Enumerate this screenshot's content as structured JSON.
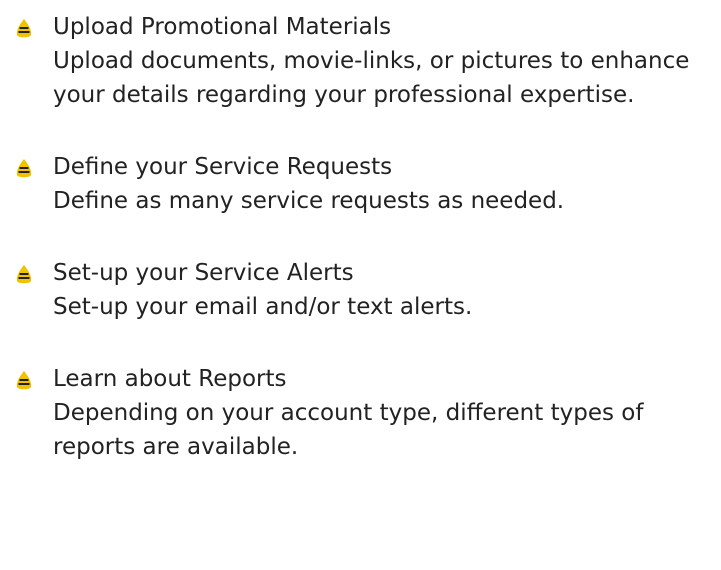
{
  "bullet_colors": {
    "fill": "#f2c200",
    "stripe": "#222222"
  },
  "items": [
    {
      "title": "Upload Promotional Materials",
      "description": "Upload documents, movie-links, or pictures to enhance your details regarding your professional expertise."
    },
    {
      "title": "Define your Service Requests",
      "description": "Define as many service requests as needed."
    },
    {
      "title": "Set-up your Service Alerts",
      "description": "Set-up your email and/or text alerts."
    },
    {
      "title": "Learn about Reports",
      "description": "Depending on your account type, different types of reports are available."
    }
  ]
}
